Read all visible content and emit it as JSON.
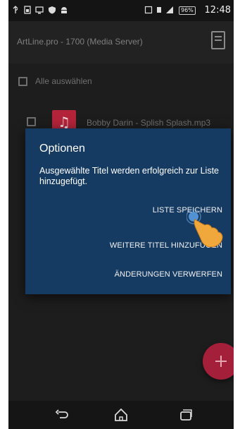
{
  "status_bar": {
    "battery_percent": "96%",
    "time": "12:48"
  },
  "app_bar": {
    "title": "ArtLine.pro - 1700 (Media Server)"
  },
  "select_all": {
    "label": "Alle auswählen"
  },
  "track": {
    "name": "Bobby Darin - Splish Splash.mp3"
  },
  "dialog": {
    "title": "Optionen",
    "message": "Ausgewählte Titel werden erfolgreich zur Liste hinzugefügt.",
    "buttons": {
      "save": "LISTE SPEICHERN",
      "add_more": "WEITERE TITEL HINZUFÜGEN",
      "discard": "ÄNDERUNGEN VERWERFEN"
    }
  },
  "colors": {
    "dialog_bg": "#163b62",
    "fab": "#a31f3a",
    "screen_bg": "#1d1d1d",
    "music_icon": "#b3243a"
  },
  "icons": {
    "fab": "plus-icon",
    "track": "music-note-icon",
    "nav": [
      "back-icon",
      "home-icon",
      "recent-apps-icon"
    ]
  }
}
